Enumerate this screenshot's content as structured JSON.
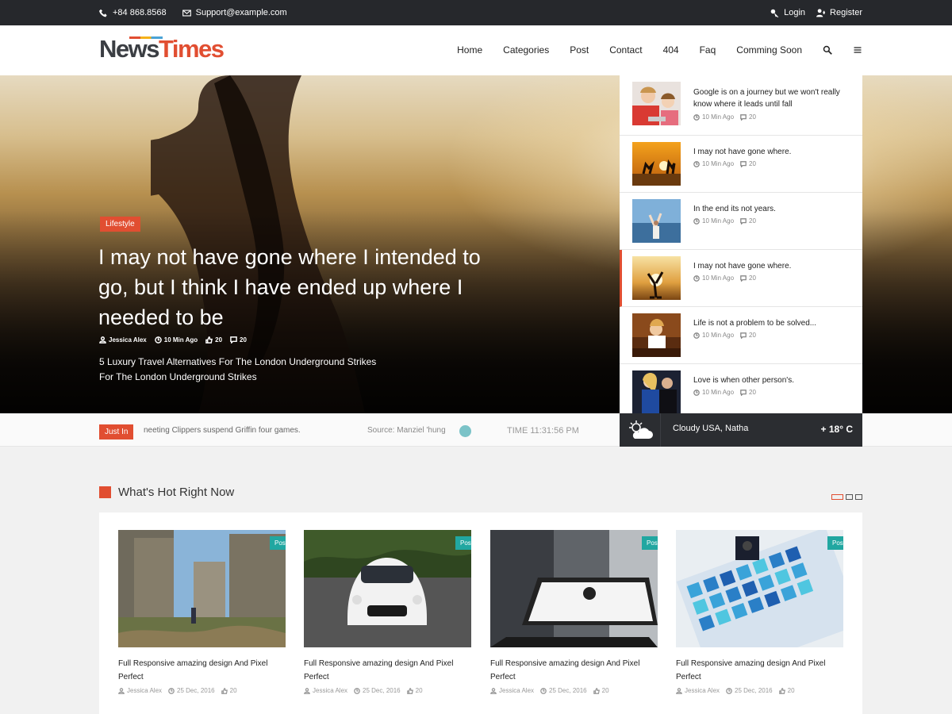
{
  "topbar": {
    "phone": "+84 868.8568",
    "email": "Support@example.com",
    "login": "Login",
    "register": "Register"
  },
  "header": {
    "logo_part1": "News",
    "logo_part2": "Times",
    "nav": [
      "Home",
      "Categories",
      "Post",
      "Contact",
      "404",
      "Faq",
      "Comming Soon"
    ]
  },
  "hero": {
    "tag": "Lifestyle",
    "title": "I may not have gone where I intended to go, but I think I have ended up where I needed to be",
    "author": "Jessica Alex",
    "time": "10 Min Ago",
    "likes": "20",
    "comments": "20",
    "subtitle_line1": "5 Luxury Travel Alternatives For The London Underground Strikes",
    "subtitle_line2": "For The London Underground Strikes"
  },
  "sidelist": [
    {
      "title": "Google is on a journey but we won't really know where it leads until fall",
      "time": "10 Min Ago",
      "comments": "20"
    },
    {
      "title": "I may not have gone where.",
      "time": "10 Min Ago",
      "comments": "20"
    },
    {
      "title": "In the end its not years.",
      "time": "10 Min Ago",
      "comments": "20"
    },
    {
      "title": "I may not have gone where.",
      "time": "10 Min Ago",
      "comments": "20"
    },
    {
      "title": "Life is not a problem to be solved...",
      "time": "10 Min Ago",
      "comments": "20"
    },
    {
      "title": "Love is when other person's.",
      "time": "10 Min Ago",
      "comments": "20"
    }
  ],
  "ticker": {
    "label": "Just In",
    "headline": "neeting Clippers suspend Griffin four games.",
    "source": "Source: Manziel 'hung",
    "time": "TIME 11:31:56 PM"
  },
  "weather": {
    "location": "Cloudy USA, Natha",
    "temp": "+ 18° C"
  },
  "section": {
    "title": "What's Hot Right Now"
  },
  "cards": [
    {
      "badge": "Post",
      "title": "Full Responsive amazing design And Pixel Perfect",
      "author": "Jessica Alex",
      "date": "25 Dec, 2016",
      "likes": "20"
    },
    {
      "badge": "Post",
      "title": "Full Responsive amazing design And Pixel Perfect",
      "author": "Jessica Alex",
      "date": "25 Dec, 2016",
      "likes": "20"
    },
    {
      "badge": "Post",
      "title": "Full Responsive amazing design And Pixel Perfect",
      "author": "Jessica Alex",
      "date": "25 Dec, 2016",
      "likes": "20"
    },
    {
      "badge": "Post",
      "title": "Full Responsive amazing design And Pixel Perfect",
      "author": "Jessica Alex",
      "date": "25 Dec, 2016",
      "likes": "20"
    }
  ]
}
